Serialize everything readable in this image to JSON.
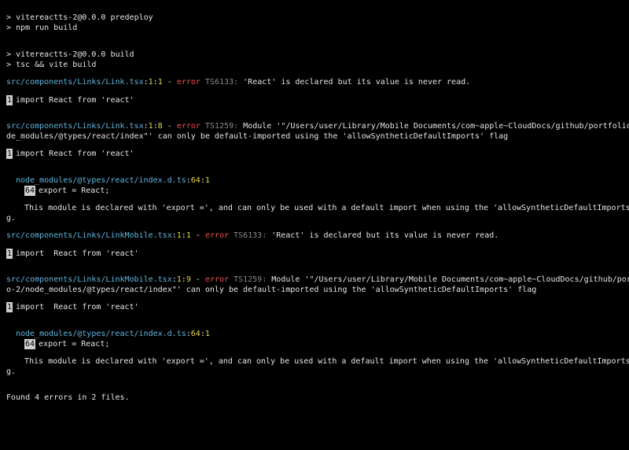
{
  "terminal": {
    "prompt_symbol": ">",
    "script1_name": "vitereactts-2@0.0.0 predeploy",
    "script1_cmd": "npm run build",
    "script2_name": "vitereactts-2@0.0.0 build",
    "script2_cmd": "tsc && vite build",
    "errors": [
      {
        "file": "src/components/Links/Link.tsx",
        "line": "1",
        "col": "1",
        "dash": "-",
        "level": "error",
        "code": "TS6133:",
        "message": "'React' is declared but its value is never read.",
        "snippet_line": "1",
        "snippet": "import React from 'react'"
      },
      {
        "file": "src/components/Links/Link.tsx",
        "line": "1",
        "col": "8",
        "dash": "-",
        "level": "error",
        "code": "TS1259:",
        "message_l1": "Module '\"/Users/user/Library/Mobile Documents/com~apple~CloudDocs/github/portfolio-2/no",
        "message_l2": "de_modules/@types/react/index\"' can only be default-imported using the 'allowSyntheticDefaultImports' flag",
        "snippet_line": "1",
        "snippet": "import React from 'react'",
        "related_file": "node_modules/@types/react/index.d.ts",
        "related_line": "64",
        "related_col": "1",
        "related_snippet_line": "64",
        "related_snippet": "export = React;",
        "note_l1": "This module is declared with 'export =', and can only be used with a default import when using the 'allowSyntheticDefaultImports' fla",
        "note_l2": "g."
      },
      {
        "file": "src/components/Links/LinkMobile.tsx",
        "line": "1",
        "col": "1",
        "dash": "-",
        "level": "error",
        "code": "TS6133:",
        "message": "'React' is declared but its value is never read.",
        "snippet_line": "1",
        "snippet": "import  React from 'react'"
      },
      {
        "file": "src/components/Links/LinkMobile.tsx",
        "line": "1",
        "col": "9",
        "dash": "-",
        "level": "error",
        "code": "TS1259:",
        "message_l1": "Module '\"/Users/user/Library/Mobile Documents/com~apple~CloudDocs/github/portfoli",
        "message_l2": "o-2/node_modules/@types/react/index\"' can only be default-imported using the 'allowSyntheticDefaultImports' flag",
        "snippet_line": "1",
        "snippet": "import  React from 'react'",
        "related_file": "node_modules/@types/react/index.d.ts",
        "related_line": "64",
        "related_col": "1",
        "related_snippet_line": "64",
        "related_snippet": "export = React;",
        "note_l1": "This module is declared with 'export =', and can only be used with a default import when using the 'allowSyntheticDefaultImports' fla",
        "note_l2": "g."
      }
    ],
    "summary": "Found 4 errors in 2 files."
  },
  "colors": {
    "background": "#000000",
    "text": "#e6e6e6",
    "path": "#5fb7e0",
    "position": "#e6d94a",
    "error": "#ef5350",
    "code": "#8a8a8a",
    "squiggle_error": "#ef5350",
    "squiggle_info": "#5fb7e0"
  }
}
